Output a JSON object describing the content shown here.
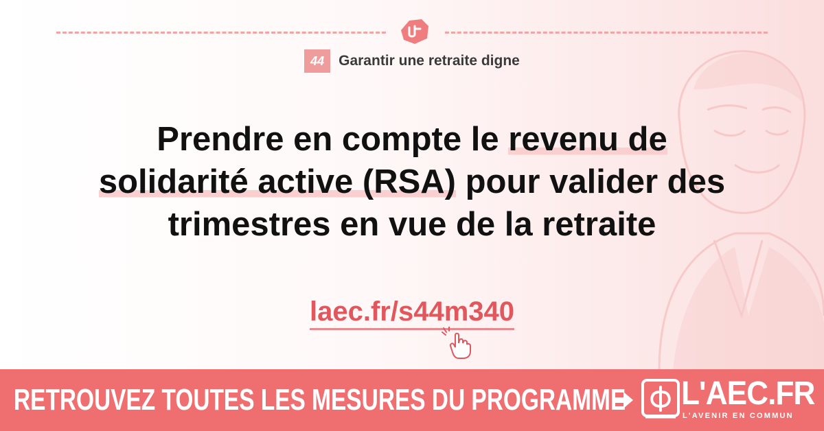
{
  "header": {
    "badge_number": "44",
    "category": "Garantir une retraite digne"
  },
  "headline": {
    "part1": "Prendre en compte le ",
    "highlight1": "revenu de",
    "part2": " ",
    "highlight2": "solidarité active (RSA)",
    "part3": " pour valider des trimestres en vue de la retraite"
  },
  "link": {
    "text": "laec.fr/s44m340"
  },
  "footer": {
    "cta": "RETROUVEZ TOUTES LES MESURES DU PROGRAMME",
    "logo_title": "L'AEC.FR",
    "logo_tagline": "L'AVENIR EN COMMUN"
  },
  "icons": [
    "handshake-icon",
    "pointing-hand-cursor-icon",
    "arrow-right-icon",
    "phi-logo-icon"
  ],
  "colors": {
    "accent": "#ef6f71",
    "link": "#e0585d",
    "badge": "#ef9c9c",
    "highlight": "#f9cfcf"
  }
}
